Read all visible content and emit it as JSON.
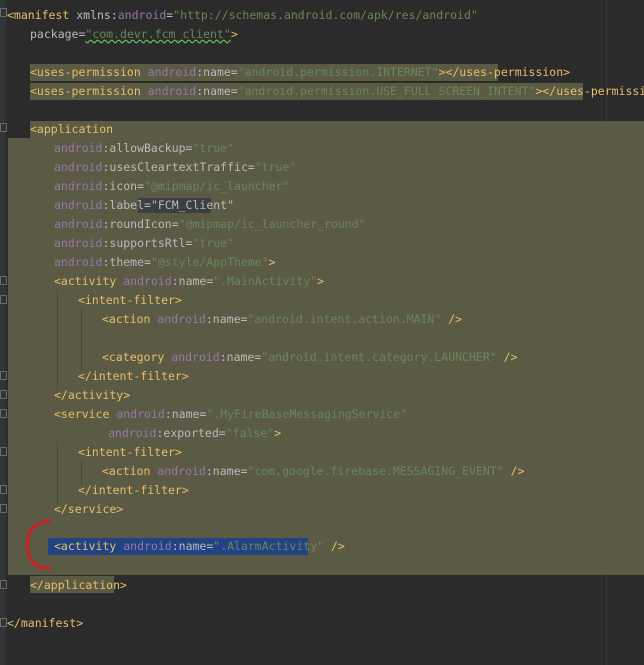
{
  "editor": {
    "language": "xml",
    "colors": {
      "background": "#2b2b2b",
      "block_highlight": "#5b5b45",
      "selection": "#214283",
      "annotation_mark": "#cc1f1f",
      "tag": "#e8bf6a",
      "namespace": "#9876aa",
      "string": "#6a8759"
    }
  },
  "lines": [
    {
      "t1": "<manifest",
      "t2": " xmlns:",
      "t3": "android",
      "t4": "=",
      "t5": "\"http://schemas.android.com/apk/res/android\""
    },
    {
      "t1": "package",
      "t2": "=",
      "t3": "\"com.devr.fcm_client\"",
      "t4": ">"
    },
    {
      "t1": "<uses-permission",
      "t2": "android",
      "t3": ":name=",
      "t4": "\"android.permission.INTERNET\"",
      "t5": "></uses-permission>"
    },
    {
      "t1": "<uses-permission",
      "t2": "android",
      "t3": ":name=",
      "t4": "\"android.permission.USE_FULL_SCREEN_INTENT\"",
      "t5": "></uses-permission>"
    },
    {
      "t1": "<application"
    },
    {
      "t1": "android",
      "t2": ":allowBackup=",
      "t3": "\"true\""
    },
    {
      "t1": "android",
      "t2": ":usesCleartextTraffic=",
      "t3": "\"true\""
    },
    {
      "t1": "android",
      "t2": ":icon=",
      "t3": "\"@mipmap/ic_launcher\""
    },
    {
      "t1": "android",
      "t2": ":label=",
      "t3": "\"FCM_Client\""
    },
    {
      "t1": "android",
      "t2": ":roundIcon=",
      "t3": "\"@mipmap/ic_launcher_round\""
    },
    {
      "t1": "android",
      "t2": ":supportsRtl=",
      "t3": "\"true\""
    },
    {
      "t1": "android",
      "t2": ":theme=",
      "t3": "\"@style/AppTheme\"",
      "t4": ">"
    },
    {
      "t1": "<activity",
      "t2": "android",
      "t3": ":name=",
      "t4": "\".MainActivity\"",
      "t5": ">"
    },
    {
      "t1": "<intent-filter>"
    },
    {
      "t1": "<action",
      "t2": "android",
      "t3": ":name=",
      "t4": "\"android.intent.action.MAIN\"",
      "t5": " />"
    },
    {
      "t1": "<category",
      "t2": "android",
      "t3": ":name=",
      "t4": "\"android.intent.category.LAUNCHER\"",
      "t5": " />"
    },
    {
      "t1": "</intent-filter>"
    },
    {
      "t1": "</activity>"
    },
    {
      "t1": "<service",
      "t2": "android",
      "t3": ":name=",
      "t4": "\".MyFireBaseMessagingService\""
    },
    {
      "t1": "android",
      "t2": ":exported=",
      "t3": "\"false\"",
      "t4": ">"
    },
    {
      "t1": "<intent-filter>"
    },
    {
      "t1": "<action",
      "t2": "android",
      "t3": ":name=",
      "t4": "\"com.google.firebase.MESSAGING_EVENT\"",
      "t5": " />"
    },
    {
      "t1": "</intent-filter>"
    },
    {
      "t1": "</service>"
    },
    {
      "t1": "<activity",
      "t2": "android",
      "t3": ":name=",
      "t4": "\".AlarmActivity\"",
      "t5": " />"
    },
    {
      "t1": "</application>"
    },
    {
      "t1": "</manifest>"
    }
  ]
}
